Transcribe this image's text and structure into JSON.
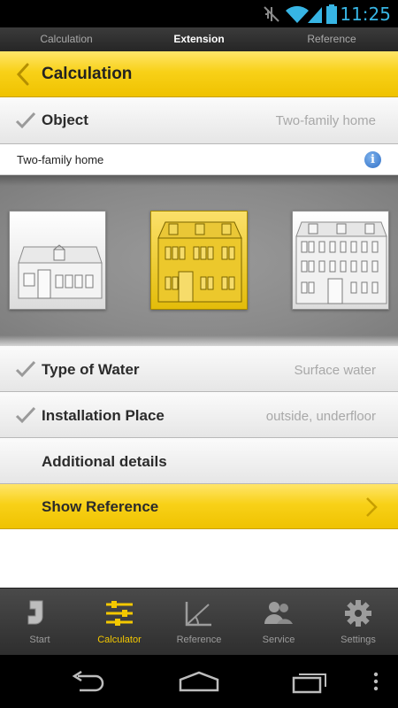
{
  "status_bar": {
    "time": "11:25",
    "icons": [
      "mute-icon",
      "wifi-icon",
      "signal-icon",
      "battery-icon"
    ]
  },
  "top_tabs": [
    {
      "label": "Calculation",
      "active": false
    },
    {
      "label": "Extension",
      "active": true
    },
    {
      "label": "Reference",
      "active": false
    }
  ],
  "header": {
    "title": "Calculation"
  },
  "object_row": {
    "label": "Object",
    "value": "Two-family home"
  },
  "subbar": {
    "label": "Two-family home",
    "info": "i"
  },
  "house_options": [
    "single-family-house",
    "two-family-house",
    "multi-family-house"
  ],
  "selected_house": 1,
  "water_row": {
    "label": "Type of Water",
    "value": "Surface water"
  },
  "installation_row": {
    "label": "Installation Place",
    "value": "outside, underfloor"
  },
  "details_row": {
    "label": "Additional details"
  },
  "reference_row": {
    "label": "Show Reference"
  },
  "bottom_nav": [
    {
      "label": "Start"
    },
    {
      "label": "Calculator"
    },
    {
      "label": "Reference"
    },
    {
      "label": "Service"
    },
    {
      "label": "Settings"
    }
  ],
  "colors": {
    "accent": "#f4c800",
    "status_time": "#37b5e4"
  }
}
